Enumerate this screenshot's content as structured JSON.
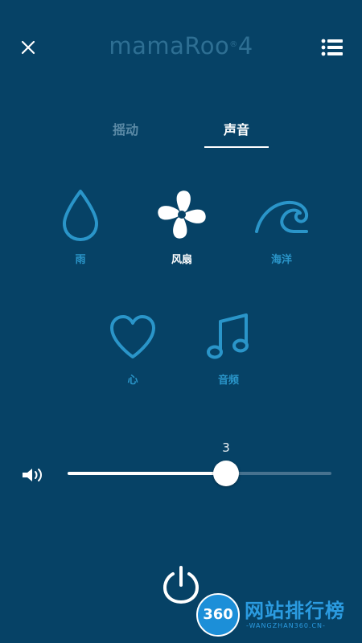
{
  "header": {
    "logo": {
      "name": "mamaRoo",
      "registered": "®",
      "version": "4"
    },
    "close_icon": "close-icon",
    "menu_icon": "menu-list-icon"
  },
  "tabs": [
    {
      "label": "摇动",
      "selected": false
    },
    {
      "label": "声音",
      "selected": true
    }
  ],
  "sounds": [
    {
      "label": "雨",
      "icon": "raindrop-icon",
      "selected": false
    },
    {
      "label": "风扇",
      "icon": "fan-icon",
      "selected": true
    },
    {
      "label": "海洋",
      "icon": "wave-icon",
      "selected": false
    },
    {
      "label": "心",
      "icon": "heart-icon",
      "selected": false
    },
    {
      "label": "音频",
      "icon": "music-note-icon",
      "selected": false
    }
  ],
  "volume": {
    "value": "3",
    "level": 0.6,
    "icon": "speaker-icon"
  },
  "power": {
    "icon": "power-icon"
  },
  "watermark": {
    "badge": "360",
    "title": "网站排行榜",
    "subtitle": "-WANGZHAN360.CN-"
  },
  "colors": {
    "background": "#064266",
    "accent": "#2a95c9",
    "logo": "#2e6f93",
    "active": "#ffffff",
    "track_inactive": "#47728f"
  }
}
